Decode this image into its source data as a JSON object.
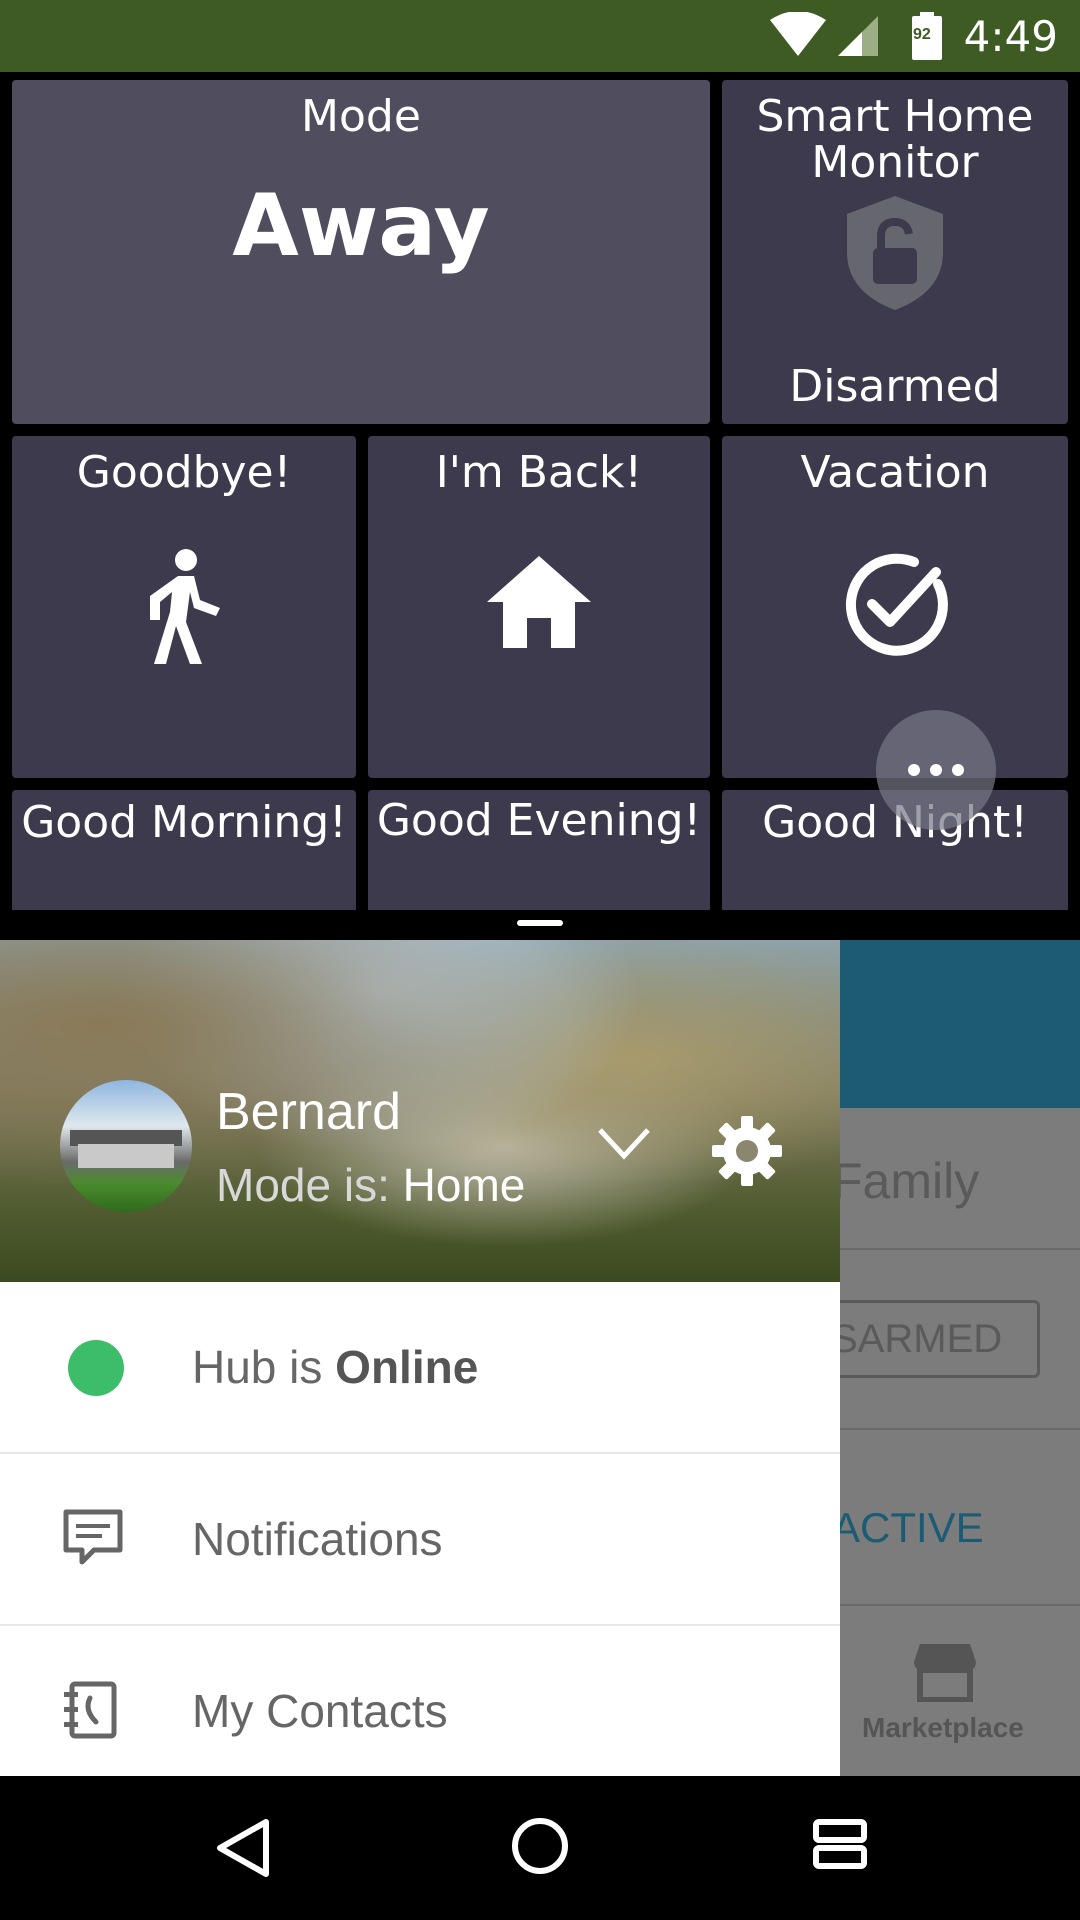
{
  "status_bar": {
    "time": "4:49",
    "battery": "92"
  },
  "tiles": {
    "mode": {
      "title": "Mode",
      "value": "Away"
    },
    "shm": {
      "title": "Smart Home Monitor",
      "status": "Disarmed"
    },
    "routines": [
      {
        "label": "Goodbye!",
        "icon": "walking-person-icon"
      },
      {
        "label": "I'm Back!",
        "icon": "home-icon"
      },
      {
        "label": "Vacation",
        "icon": "check-circle-icon"
      },
      {
        "label": "Good Morning!"
      },
      {
        "label": "Good Evening!"
      },
      {
        "label": "Good Night!"
      }
    ]
  },
  "background_screen": {
    "family_label": "Family",
    "disarmed_button": "DISARMED",
    "active_label": "ACTIVE",
    "marketplace_label": "Marketplace"
  },
  "drawer": {
    "user_name": "Bernard",
    "mode_prefix": "Mode is: ",
    "mode_value": "Home",
    "hub_prefix": "Hub is ",
    "hub_status": "Online",
    "menu_items": [
      {
        "label": "Notifications",
        "icon": "message-icon"
      },
      {
        "label": "My Contacts",
        "icon": "contacts-book-icon"
      }
    ],
    "status_color": "#3dbd6a"
  }
}
